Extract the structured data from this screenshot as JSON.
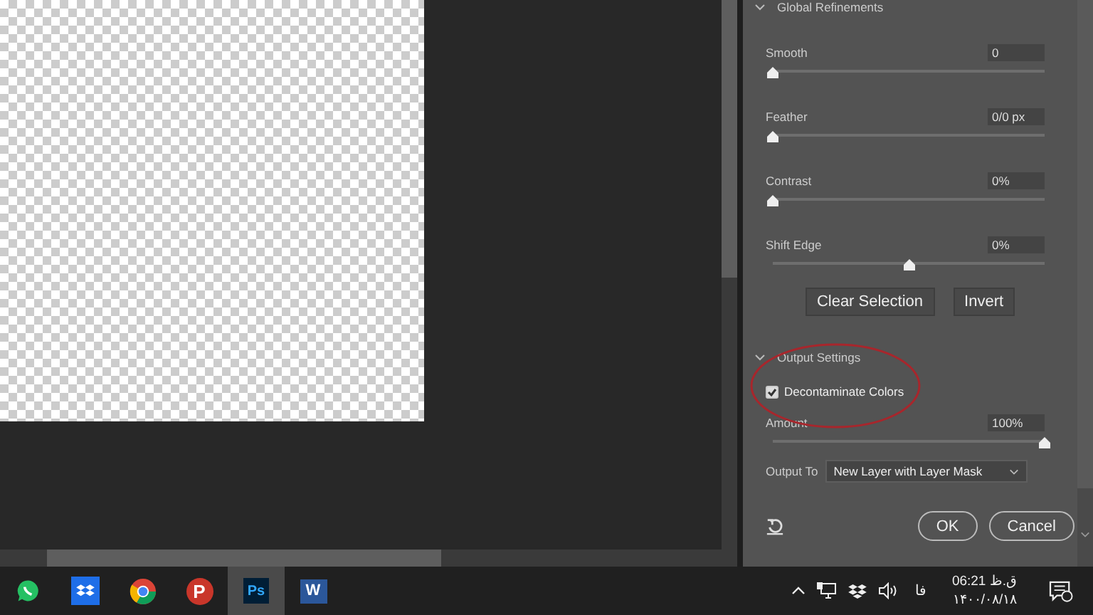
{
  "panel": {
    "global_refinements": {
      "title": "Global Refinements",
      "expanded": true,
      "sliders": [
        {
          "label": "Smooth",
          "value": "0",
          "level": 0
        },
        {
          "label": "Feather",
          "value": "0/0 px",
          "level": 0
        },
        {
          "label": "Contrast",
          "value": "0%",
          "level": 0
        },
        {
          "label": "Shift Edge",
          "value": "0%",
          "level": 0.5
        }
      ],
      "buttons": [
        "Clear Selection",
        "Invert"
      ]
    },
    "output_settings": {
      "title": "Output Settings",
      "expanded": true,
      "checkbox": {
        "label": "Decontaminate Colors",
        "checked": true
      },
      "amount": {
        "label": "Amount",
        "value": "100%",
        "level": 1
      },
      "output_to": {
        "label": "Output To",
        "value": "New Layer with Layer Mask"
      }
    },
    "buttons": [
      "OK",
      "Cancel"
    ]
  },
  "taskbar": {
    "apps": [
      {
        "selected": false
      },
      {
        "selected": false
      },
      {
        "selected": false
      },
      {
        "label": "P",
        "selected": false
      },
      {
        "label": "Ps",
        "selected": true
      },
      {
        "label": "W",
        "selected": false
      }
    ],
    "language": "فا",
    "time": "ق.ظ 06:21",
    "date": "۱۴۰۰/۰۸/۱۸"
  }
}
